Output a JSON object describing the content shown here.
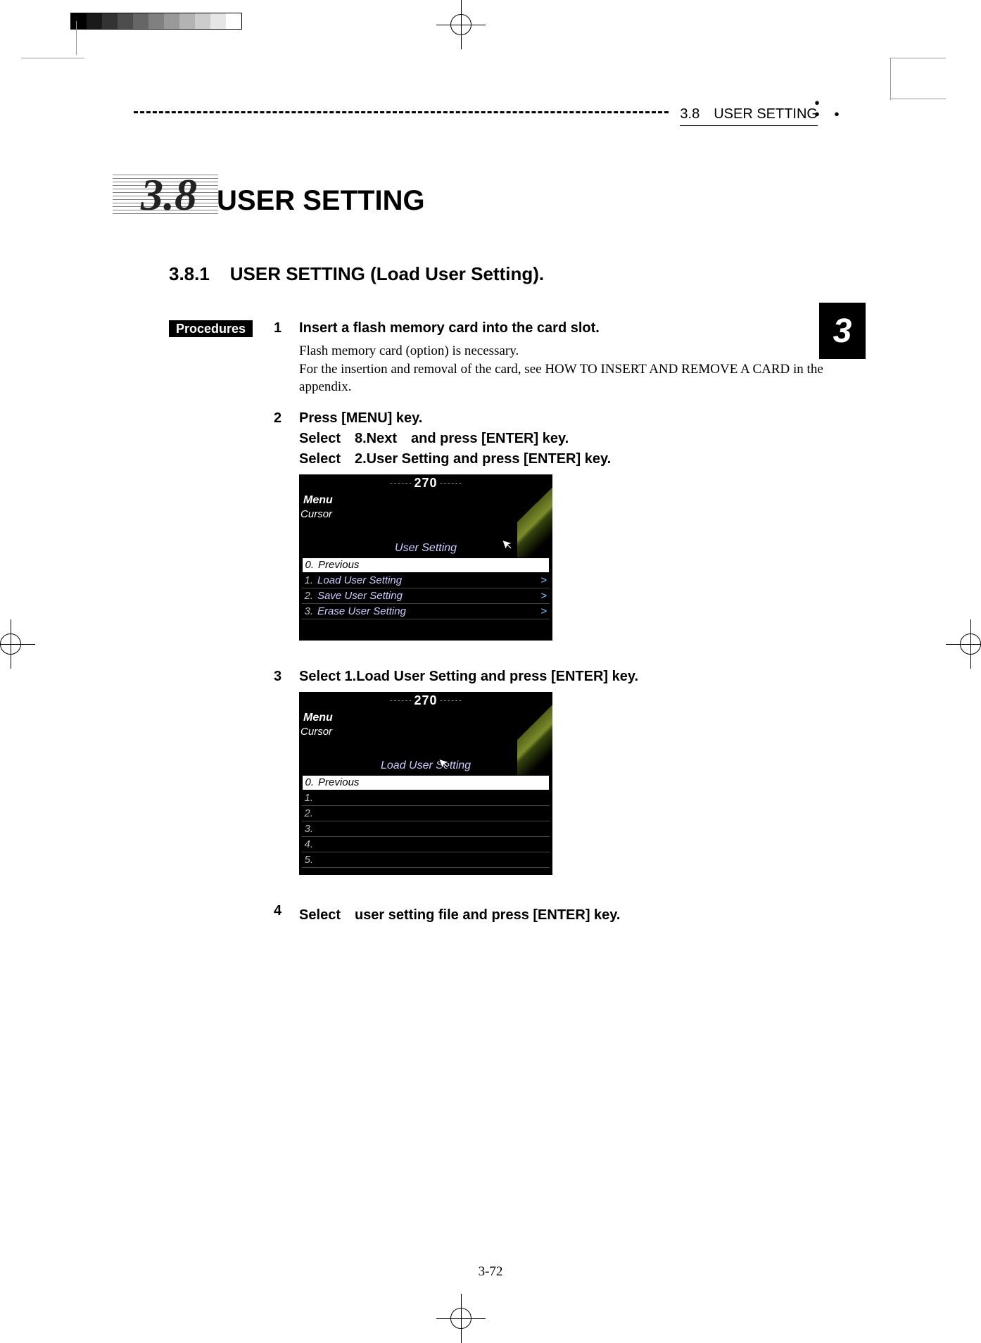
{
  "header": {
    "running_header": "3.8　USER SETTING"
  },
  "chapter_tab": "3",
  "section": {
    "number": "3.8",
    "title": "USER SETTING"
  },
  "subsection": {
    "number": "3.8.1",
    "title": "USER SETTING (Load User Setting)."
  },
  "procedures_label": "Procedures",
  "steps": [
    {
      "num": "1",
      "title": "Insert a flash memory card into the card slot.",
      "desc": "Flash memory card (option) is necessary.\nFor the insertion and removal of the card, see HOW TO INSERT AND REMOVE A CARD in the appendix."
    },
    {
      "num": "2",
      "title": "Press [MENU] key.\nSelect　8.Next　and press [ENTER] key.\nSelect　2.User Setting and press [ENTER] key."
    },
    {
      "num": "3",
      "title": "Select 1.Load User Setting and press [ENTER] key."
    },
    {
      "num": "4",
      "title": "Select　user setting file and press [ENTER] key."
    }
  ],
  "screenshot1": {
    "compass": "270",
    "menu_label": "Menu",
    "cursor_label": "Cursor",
    "menu_title": "User Setting",
    "items": [
      {
        "idx": "0.",
        "label": "Previous",
        "selected": true
      },
      {
        "idx": "1.",
        "label": "Load User Setting",
        "arrow": ">"
      },
      {
        "idx": "2.",
        "label": "Save User Setting",
        "arrow": ">"
      },
      {
        "idx": "3.",
        "label": "Erase User Setting",
        "arrow": ">"
      }
    ]
  },
  "screenshot2": {
    "compass": "270",
    "menu_label": "Menu",
    "cursor_label": "Cursor",
    "menu_title": "Load User Setting",
    "items": [
      {
        "idx": "0.",
        "label": "Previous",
        "selected": true
      },
      {
        "idx": "1.",
        "label": ""
      },
      {
        "idx": "2.",
        "label": ""
      },
      {
        "idx": "3.",
        "label": ""
      },
      {
        "idx": "4.",
        "label": ""
      },
      {
        "idx": "5.",
        "label": ""
      }
    ]
  },
  "page_number": "3-72"
}
